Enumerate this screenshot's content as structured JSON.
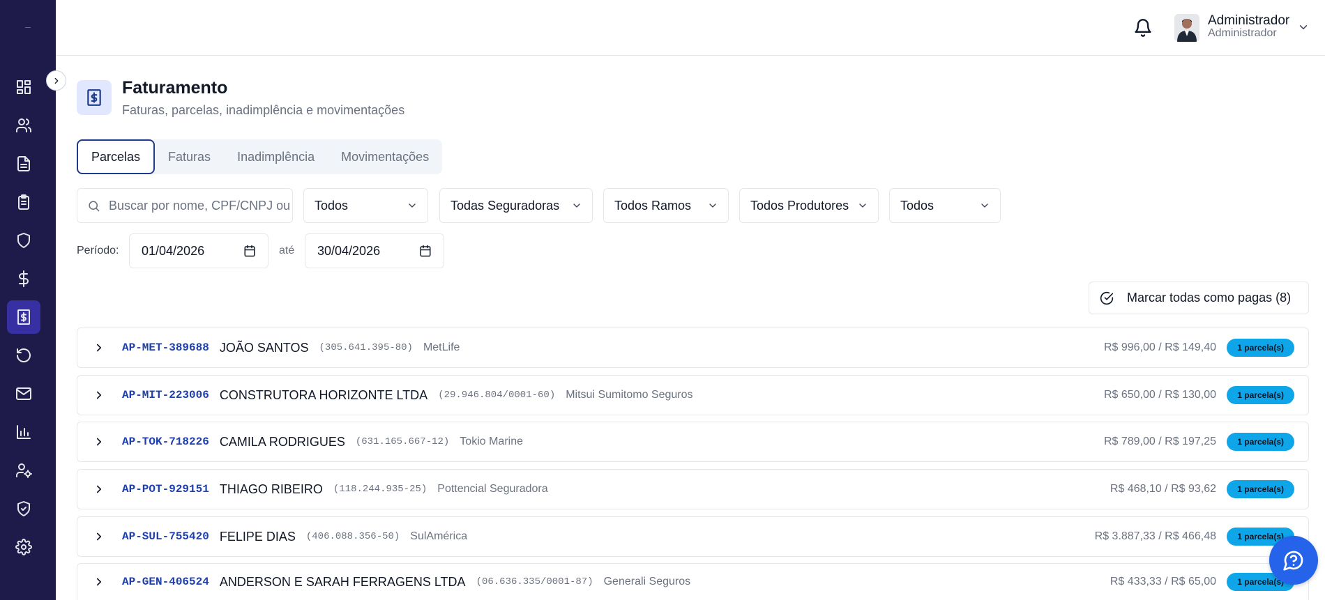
{
  "sidebar": {
    "logo": "–",
    "items": [
      {
        "icon": "dashboard-icon"
      },
      {
        "icon": "users-icon"
      },
      {
        "icon": "document-icon"
      },
      {
        "icon": "clipboard-icon"
      },
      {
        "icon": "shield-icon"
      },
      {
        "icon": "dollar-icon"
      },
      {
        "icon": "billing-icon",
        "active": true
      },
      {
        "icon": "history-icon"
      },
      {
        "icon": "mail-icon"
      },
      {
        "icon": "chart-icon"
      },
      {
        "icon": "user-settings-icon"
      },
      {
        "icon": "shield-check-icon"
      },
      {
        "icon": "gear-icon"
      }
    ]
  },
  "topbar": {
    "user_name": "Administrador",
    "user_role": "Administrador"
  },
  "header": {
    "title": "Faturamento",
    "subtitle": "Faturas, parcelas, inadimplência e movimentações"
  },
  "tabs": [
    "Parcelas",
    "Faturas",
    "Inadimplência",
    "Movimentações"
  ],
  "filters": {
    "search_placeholder": "Buscar por nome, CPF/CNPJ ou apólice",
    "status": "Todos",
    "insurers": "Todas Seguradoras",
    "branches": "Todos Ramos",
    "producers": "Todos Produtores",
    "other": "Todos",
    "period_label": "Período:",
    "date_from": "01/04/2026",
    "to_label": "até",
    "date_to": "30/04/2026"
  },
  "mark_all_label": "Marcar todas como pagas (8)",
  "rows": [
    {
      "code": "AP-MET-389688",
      "name": "JOÃO SANTOS",
      "doc": "(305.641.395-80)",
      "insurer": "MetLife",
      "amount": "R$ 996,00 / R$ 149,40",
      "badge": "1 parcela(s)"
    },
    {
      "code": "AP-MIT-223006",
      "name": "CONSTRUTORA HORIZONTE LTDA",
      "doc": "(29.946.804/0001-60)",
      "insurer": "Mitsui Sumitomo Seguros",
      "amount": "R$ 650,00 / R$ 130,00",
      "badge": "1 parcela(s)"
    },
    {
      "code": "AP-TOK-718226",
      "name": "CAMILA RODRIGUES",
      "doc": "(631.165.667-12)",
      "insurer": "Tokio Marine",
      "amount": "R$ 789,00 / R$ 197,25",
      "badge": "1 parcela(s)"
    },
    {
      "code": "AP-POT-929151",
      "name": "THIAGO RIBEIRO",
      "doc": "(118.244.935-25)",
      "insurer": "Pottencial Seguradora",
      "amount": "R$ 468,10 / R$ 93,62",
      "badge": "1 parcela(s)"
    },
    {
      "code": "AP-SUL-755420",
      "name": "FELIPE DIAS",
      "doc": "(406.088.356-50)",
      "insurer": "SulAmérica",
      "amount": "R$ 3.887,33 / R$ 466,48",
      "badge": "1 parcela(s)"
    },
    {
      "code": "AP-GEN-406524",
      "name": "ANDERSON E SARAH FERRAGENS LTDA",
      "doc": "(06.636.335/0001-87)",
      "insurer": "Generali Seguros",
      "amount": "R$ 433,33 / R$ 65,00",
      "badge": "1 parcela(s)"
    }
  ],
  "colors": {
    "sidebar_bg": "#1e1b4b",
    "accent": "#1e3a8a",
    "code_blue": "#1e40af",
    "badge_bg": "#0ea5e9",
    "fab_bg": "#2563eb"
  }
}
